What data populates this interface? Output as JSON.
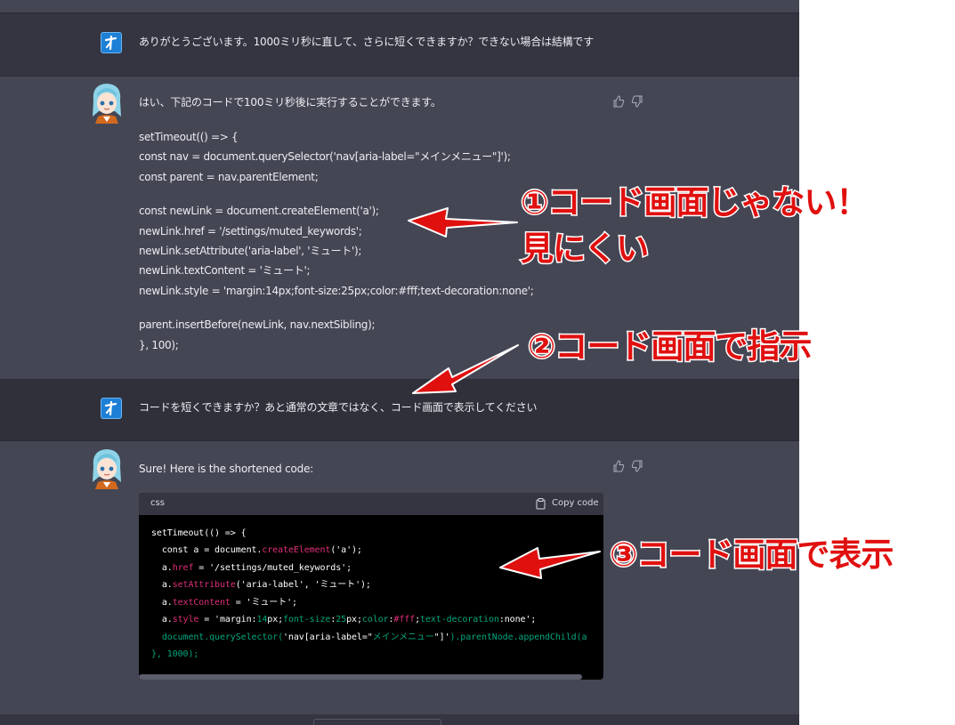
{
  "messages": {
    "user1": {
      "text": "ありがとうございます。1000ミリ秒に直して、さらに短くできますか？できない場合は結構です"
    },
    "bot1": {
      "intro": "はい、下記のコードで100ミリ秒後に実行することができます。",
      "lines": [
        "setTimeout(() => {",
        "const nav = document.querySelector('nav[aria-label=\"メインメニュー\"]');",
        "const parent = nav.parentElement;",
        "const newLink = document.createElement('a');",
        "newLink.href = '/settings/muted_keywords';",
        "newLink.setAttribute('aria-label', 'ミュート');",
        "newLink.textContent = 'ミュート';",
        "newLink.style = 'margin:14px;font-size:25px;color:#fff;text-decoration:none';",
        "parent.insertBefore(newLink, nav.nextSibling);",
        "}, 100);"
      ]
    },
    "user2": {
      "text": "コードを短くできますか？あと通常の文章ではなく、コード画面で表示してください"
    },
    "bot2": {
      "intro": "Sure! Here is the shortened code:",
      "code_lang": "css",
      "copy_label": "Copy code",
      "code_lines": {
        "l1": "setTimeout(() => {",
        "l2a": "  const a = document.",
        "l2b": "createElement",
        "l2c": "('a');",
        "l3a": "  a.",
        "l3b": "href",
        "l3c": " = '/settings/muted_keywords';",
        "l4a": "  a.",
        "l4b": "setAttribute",
        "l4c": "('aria-label', 'ミュート');",
        "l5a": "  a.",
        "l5b": "textContent",
        "l5c": " = 'ミュート';",
        "l6a": "  a.",
        "l6b": "style",
        "l6c": " = 'margin:",
        "l6d": "14",
        "l6e": "px;",
        "l6f": "font-size",
        "l6g": ":",
        "l6h": "25",
        "l6i": "px;",
        "l6j": "color",
        "l6k": ":",
        "l6l": "#fff",
        "l6m": ";",
        "l6n": "text-decoration",
        "l6o": ":none';",
        "l7a": "  document.querySelector(",
        "l7b": "'nav[aria-label=\"",
        "l7c": "メインメニュー",
        "l7d": "\"]'",
        "l7e": ").parentNode.appendChild(a",
        "l8a": "}, ",
        "l8b": "1000",
        "l8c": ");"
      }
    }
  },
  "annotations": {
    "callout1_line1": "①コード画面じゃない！",
    "callout1_line2": "見にくい",
    "callout2": "②コード画面で指示",
    "callout3": "③コード画面で表示"
  },
  "colors": {
    "user_bg": "#343541",
    "bot_bg": "#444654",
    "code_bg": "#000000",
    "annotation_red": "#e0100f",
    "keyword_pink": "#df3079",
    "string_green": "#00a67d"
  },
  "icons": {
    "user_avatar": "user-avatar-icon",
    "bot_avatar": "anime-girl-avatar",
    "thumbs_up": "thumbs-up-icon",
    "thumbs_down": "thumbs-down-icon",
    "copy": "clipboard-icon",
    "arrow": "red-arrow-icon"
  }
}
